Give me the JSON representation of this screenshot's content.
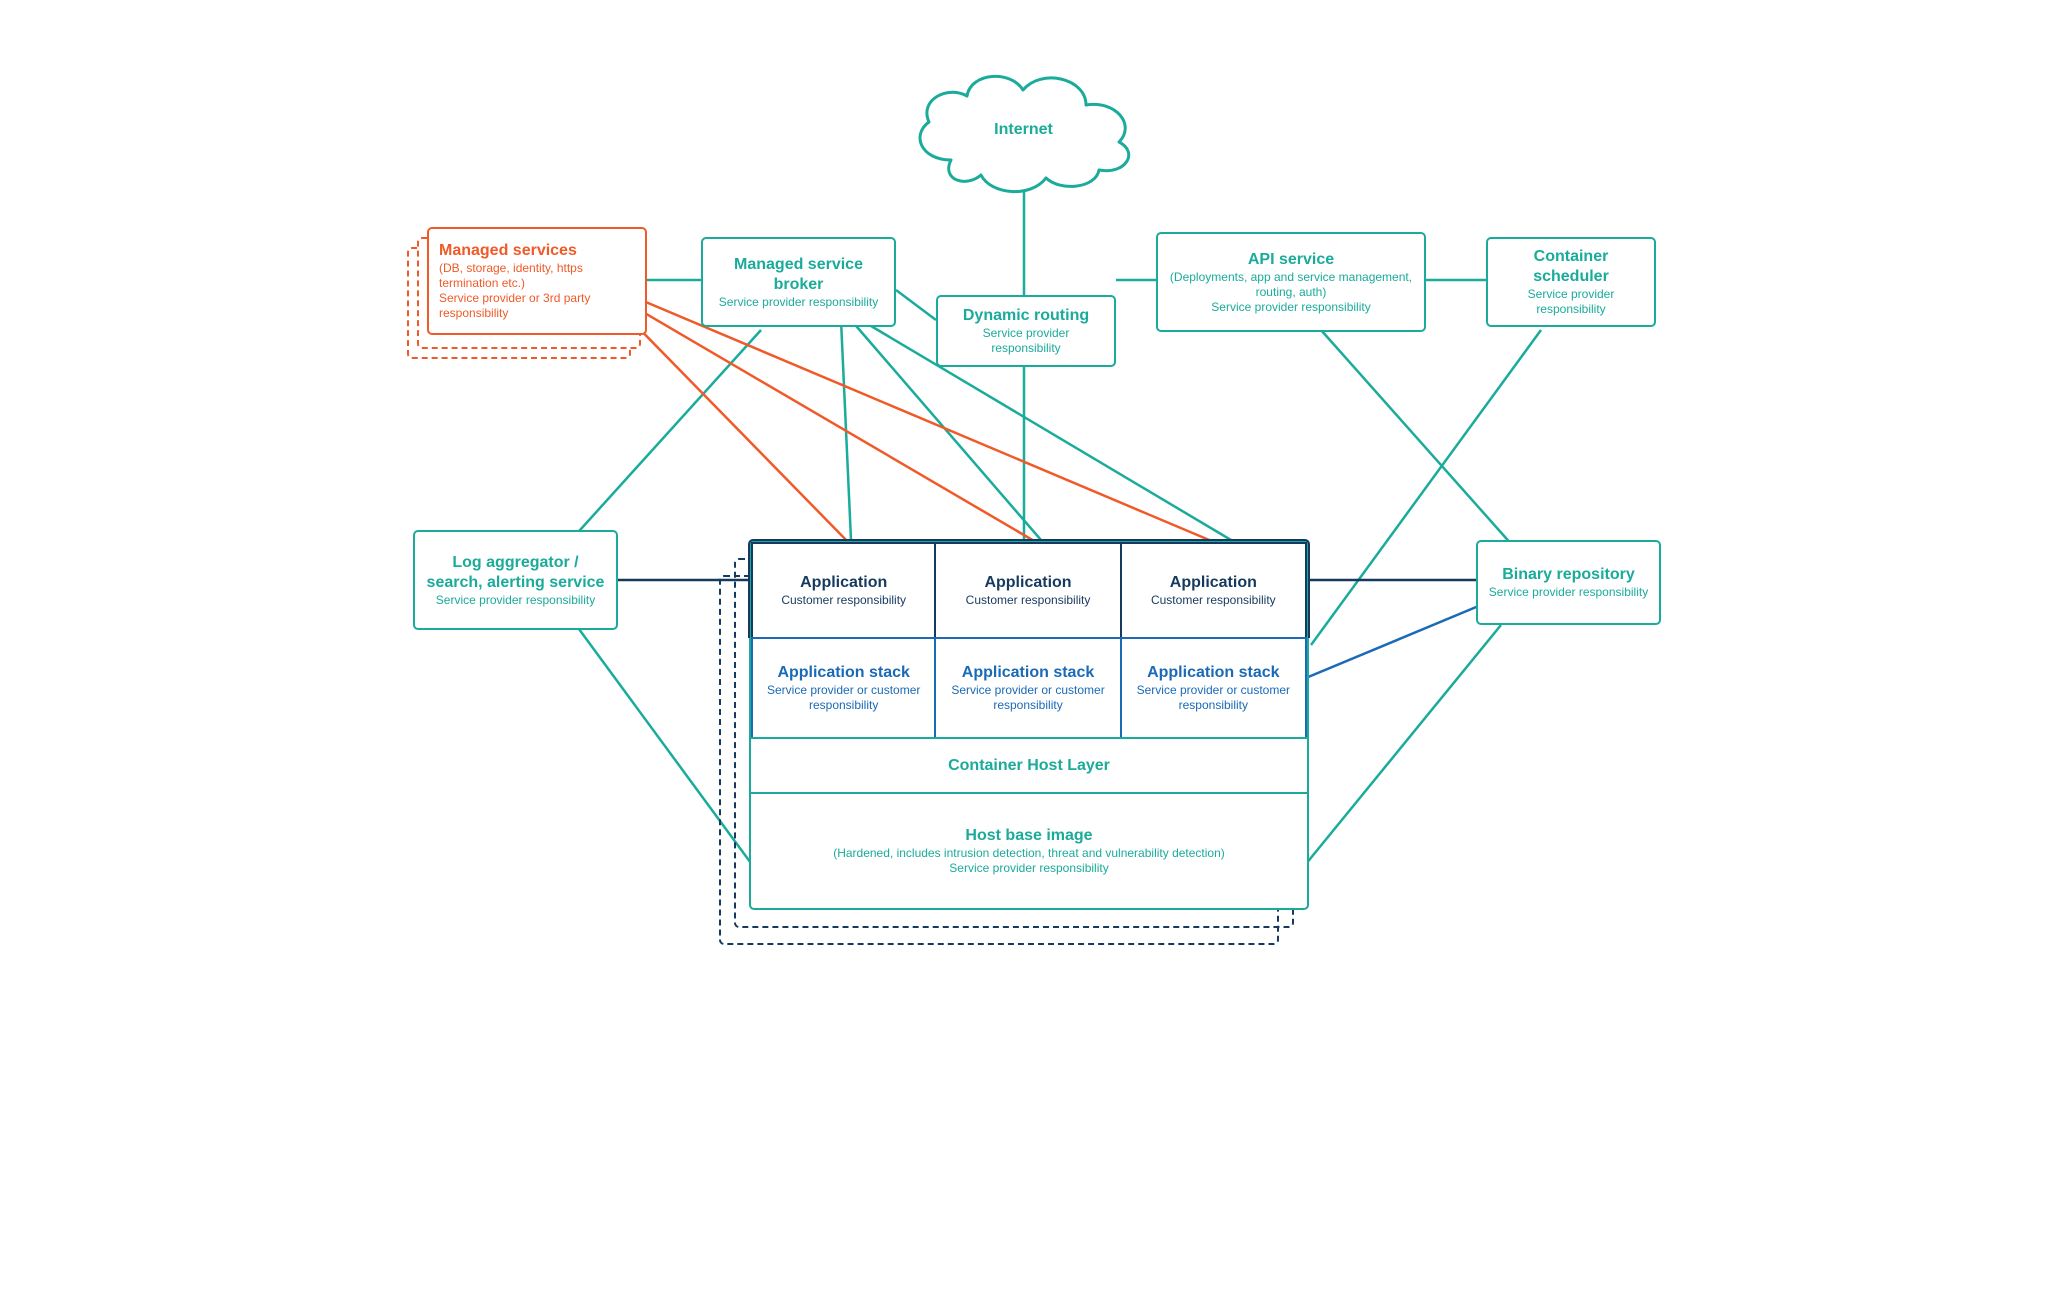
{
  "colors": {
    "teal": "#1aab9b",
    "orange": "#f05a28",
    "navy": "#163a5f",
    "blue": "#1a6ab7"
  },
  "internet": {
    "label": "Internet"
  },
  "managedServices": {
    "title": "Managed services",
    "detail": "(DB, storage, identity, https termination etc.)",
    "resp": "Service provider or 3rd party responsibility"
  },
  "managedServiceBroker": {
    "title": "Managed service broker",
    "resp": "Service provider responsibility"
  },
  "dynamicRouting": {
    "title": "Dynamic routing",
    "resp": "Service provider responsibility"
  },
  "apiService": {
    "title": "API service",
    "detail": "(Deployments, app and service management, routing, auth)",
    "resp": "Service provider responsibility"
  },
  "containerScheduler": {
    "title": "Container scheduler",
    "resp": "Service provider responsibility"
  },
  "logAggregator": {
    "title": "Log aggregator / search, alerting service",
    "resp": "Service provider responsibility"
  },
  "binaryRepo": {
    "title": "Binary repository",
    "resp": "Service provider responsibility"
  },
  "host": {
    "appCells": [
      {
        "title": "Application",
        "resp": "Customer responsibility"
      },
      {
        "title": "Application",
        "resp": "Customer responsibility"
      },
      {
        "title": "Application",
        "resp": "Customer responsibility"
      }
    ],
    "stackCells": [
      {
        "title": "Application stack",
        "resp": "Service provider or customer responsibility"
      },
      {
        "title": "Application stack",
        "resp": "Service provider or customer responsibility"
      },
      {
        "title": "Application stack",
        "resp": "Service provider or customer responsibility"
      }
    ],
    "containerHostLayer": "Container Host Layer",
    "baseImage": {
      "title": "Host base image",
      "detail": "(Hardened, includes intrusion detection, threat and vulnerability detection)",
      "resp": "Service provider responsibility"
    }
  }
}
